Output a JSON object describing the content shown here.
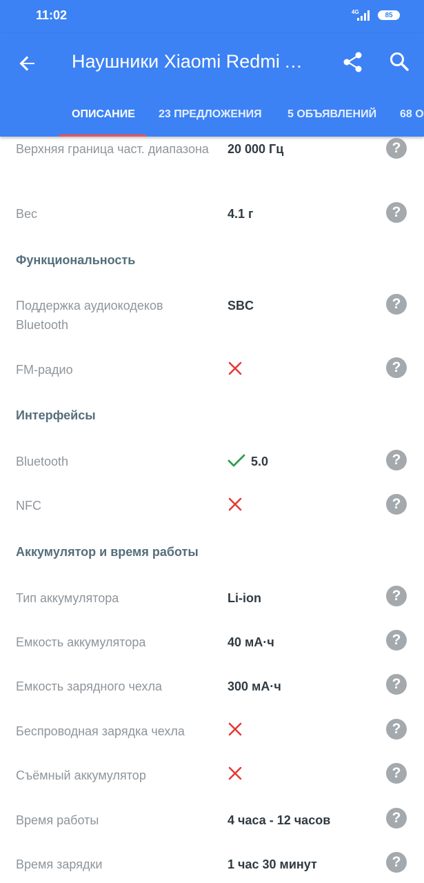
{
  "status_bar": {
    "time": "11:02",
    "network": "4G",
    "battery": "85"
  },
  "app_bar": {
    "title": "Наушники Xiaomi Redmi AirDots",
    "back_icon": "arrow-back-icon",
    "share_icon": "share-icon",
    "search_icon": "search-icon",
    "color": "#3d82f4"
  },
  "tabs": [
    {
      "label": "ОПИСАНИЕ",
      "active": true
    },
    {
      "label": "23 ПРЕДЛОЖЕНИЯ",
      "active": false
    },
    {
      "label": "5 ОБЪЯВЛЕНИЙ",
      "active": false
    },
    {
      "label": "68 О",
      "active": false
    }
  ],
  "specs": {
    "freq_upper": {
      "label": "Верхняя граница част. диапазона",
      "value": "20 000 Гц"
    },
    "weight": {
      "label": "Вес",
      "value": "4.1 г"
    },
    "section_functionality": "Функциональность",
    "bt_codecs": {
      "label": "Поддержка аудиокодеков Bluetooth",
      "value": "SBC"
    },
    "fm_radio": {
      "label": "FM-радио",
      "supported": false
    },
    "section_interfaces": "Интерфейсы",
    "bluetooth": {
      "label": "Bluetooth",
      "supported": true,
      "value": "5.0"
    },
    "nfc": {
      "label": "NFC",
      "supported": false
    },
    "section_battery": "Аккумулятор и время работы",
    "battery_type": {
      "label": "Тип аккумулятора",
      "value": "Li-ion"
    },
    "battery_capacity": {
      "label": "Емкость аккумулятора",
      "value": "40 мА·ч"
    },
    "case_capacity": {
      "label": "Емкость зарядного чехла",
      "value": "300 мА·ч"
    },
    "wireless_case": {
      "label": "Беспроводная зарядка чехла",
      "supported": false
    },
    "removable_battery": {
      "label": "Съёмный аккумулятор",
      "supported": false
    },
    "work_time": {
      "label": "Время работы",
      "value": "4 часа - 12 часов"
    },
    "charge_time": {
      "label": "Время зарядки",
      "value": "1 час 30 минут"
    }
  },
  "help_glyph": "?",
  "colors": {
    "cross": "#e53935",
    "check": "#2e9e4f",
    "help": "#a4a9ad",
    "tab_indicator": "#ef5350"
  }
}
